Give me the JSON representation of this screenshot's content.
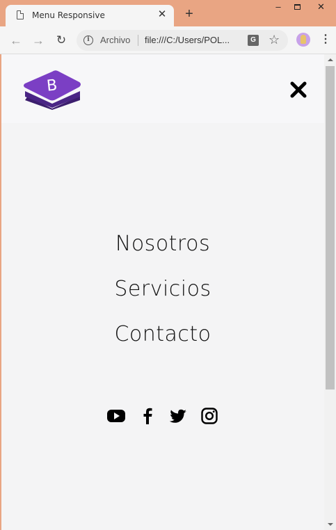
{
  "browser": {
    "tab_title": "Menu Responsive",
    "tab_close": "✕",
    "new_tab": "+",
    "address_scheme_label": "Archivo",
    "url": "file:///C:/Users/POL...",
    "translate_label": "G",
    "star": "☆",
    "menu_dots": "⋮",
    "back": "←",
    "forward": "→",
    "reload": "↻",
    "info": "i",
    "window_min": "–",
    "window_close": "✕"
  },
  "header": {
    "logo_letter": "B",
    "close_icon": "close-icon"
  },
  "menu": {
    "items": [
      {
        "label": "Nosotros"
      },
      {
        "label": "Servicios"
      },
      {
        "label": "Contacto"
      }
    ]
  },
  "social": {
    "icons": [
      "youtube-icon",
      "facebook-icon",
      "twitter-icon",
      "instagram-icon"
    ]
  },
  "colors": {
    "frame": "#e9a583",
    "logo_purple": "#7b3fc4",
    "logo_purple_dark": "#563d7c",
    "page_bg": "#f4f4f5"
  }
}
